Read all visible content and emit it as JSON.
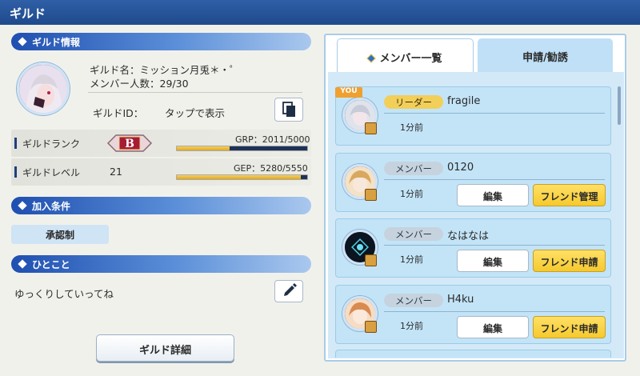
{
  "header": {
    "title": "ギルド"
  },
  "guild_info": {
    "section_title": "ギルド情報",
    "name_label": "ギルド名：",
    "name_value": "ミッション月兎＊・゜",
    "member_count_label": "メンバー人数：",
    "member_count_value": "29/30",
    "id_label": "ギルドID：",
    "id_value": "タップで表示"
  },
  "stats": {
    "rank_label": "ギルドランク",
    "rank_badge": "B",
    "grp_text": "GRP：2011/5000",
    "grp_progress": 0.4022,
    "level_label": "ギルドレベル",
    "level_value": "21",
    "gep_text": "GEP：5280/5550",
    "gep_progress": 0.9514
  },
  "join": {
    "section_title": "加入条件",
    "condition": "承認制"
  },
  "comment": {
    "section_title": "ひとこと",
    "text": "ゆっくりしていってね"
  },
  "detail_button": "ギルド詳細",
  "tabs": [
    {
      "label": "メンバー一覧",
      "active": true
    },
    {
      "label": "申請/勧誘",
      "active": false
    }
  ],
  "you_tag": "YOU",
  "members": [
    {
      "role": "リーダー",
      "name": "fragile",
      "time": "1分前"
    },
    {
      "role": "メンバー",
      "name": "0120",
      "time": "1分前",
      "edit_label": "編集",
      "friend_label": "フレンド管理"
    },
    {
      "role": "メンバー",
      "name": "なはなは",
      "time": "1分前",
      "edit_label": "編集",
      "friend_label": "フレンド申請"
    },
    {
      "role": "メンバー",
      "name": "H4ku",
      "time": "1分前",
      "edit_label": "編集",
      "friend_label": "フレンド申請"
    }
  ],
  "colors": {
    "header": "#1f4a8c",
    "section": "#1f4fb0",
    "card": "#c3e4f7",
    "friend_button": "#f5c92e",
    "leader_badge": "#f2cf58"
  },
  "icons": [
    "diamond-icon",
    "copy-icon",
    "pencil-icon",
    "rank-badge-icon",
    "level-badge-icon"
  ]
}
